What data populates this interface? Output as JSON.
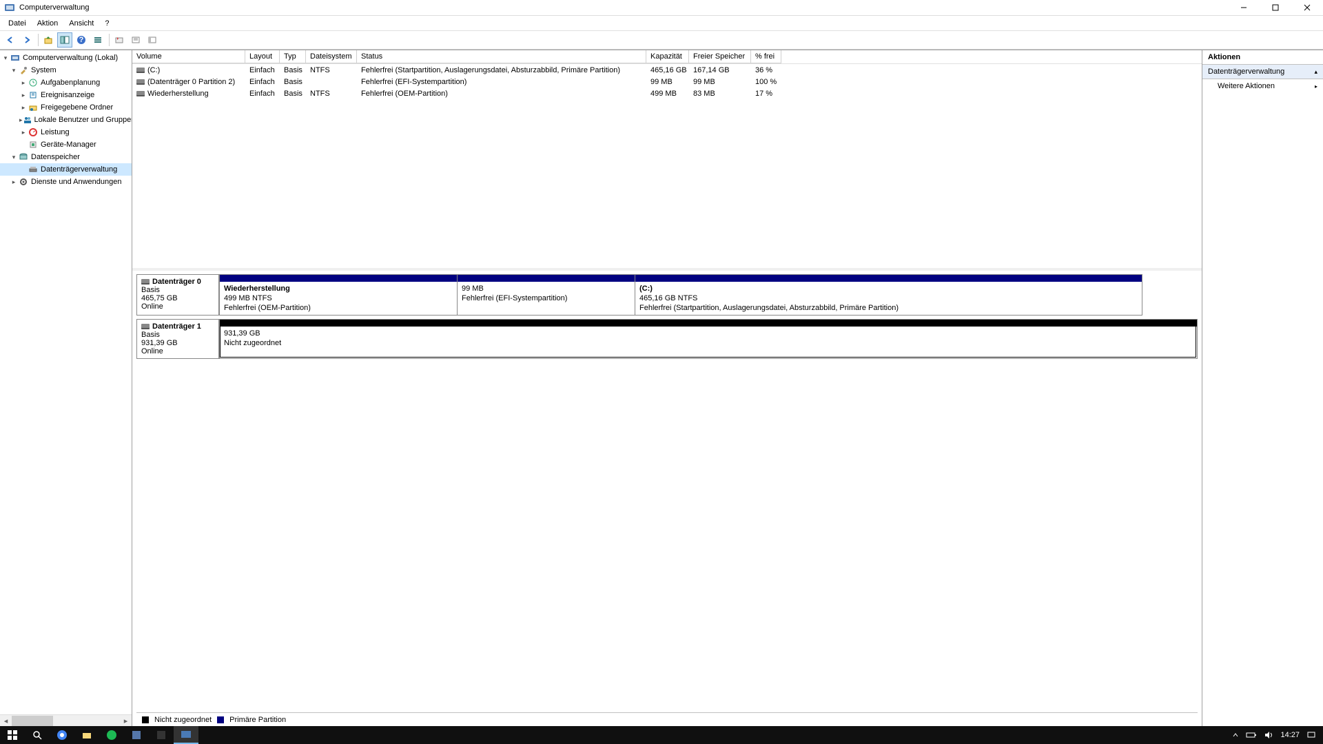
{
  "window": {
    "title": "Computerverwaltung"
  },
  "menu": {
    "file": "Datei",
    "action": "Aktion",
    "view": "Ansicht",
    "help": "?"
  },
  "tree": {
    "root": "Computerverwaltung (Lokal)",
    "system": "System",
    "taskScheduler": "Aufgabenplanung",
    "eventViewer": "Ereignisanzeige",
    "sharedFolders": "Freigegebene Ordner",
    "localUsers": "Lokale Benutzer und Gruppen",
    "performance": "Leistung",
    "deviceManager": "Geräte-Manager",
    "storage": "Datenspeicher",
    "diskMgmt": "Datenträgerverwaltung",
    "services": "Dienste und Anwendungen"
  },
  "columns": {
    "volume": "Volume",
    "layout": "Layout",
    "type": "Typ",
    "filesystem": "Dateisystem",
    "status": "Status",
    "capacity": "Kapazität",
    "free": "Freier Speicher",
    "pctfree": "% frei"
  },
  "volumes": [
    {
      "name": "(C:)",
      "layout": "Einfach",
      "type": "Basis",
      "fs": "NTFS",
      "status": "Fehlerfrei (Startpartition, Auslagerungsdatei, Absturzabbild, Primäre Partition)",
      "cap": "465,16 GB",
      "free": "167,14 GB",
      "pct": "36 %"
    },
    {
      "name": "(Datenträger 0 Partition 2)",
      "layout": "Einfach",
      "type": "Basis",
      "fs": "",
      "status": "Fehlerfrei (EFI-Systempartition)",
      "cap": "99 MB",
      "free": "99 MB",
      "pct": "100 %"
    },
    {
      "name": "Wiederherstellung",
      "layout": "Einfach",
      "type": "Basis",
      "fs": "NTFS",
      "status": "Fehlerfrei (OEM-Partition)",
      "cap": "499 MB",
      "free": "83 MB",
      "pct": "17 %"
    }
  ],
  "disk0": {
    "title": "Datenträger 0",
    "type": "Basis",
    "size": "465,75 GB",
    "state": "Online",
    "p1": {
      "name": "Wiederherstellung",
      "line2": "499 MB NTFS",
      "line3": "Fehlerfrei (OEM-Partition)"
    },
    "p2": {
      "name": "",
      "line2": "99 MB",
      "line3": "Fehlerfrei (EFI-Systempartition)"
    },
    "p3": {
      "name": "(C:)",
      "line2": "465,16 GB NTFS",
      "line3": "Fehlerfrei (Startpartition, Auslagerungsdatei, Absturzabbild, Primäre Partition)"
    }
  },
  "disk1": {
    "title": "Datenträger 1",
    "type": "Basis",
    "size": "931,39 GB",
    "state": "Online",
    "p1": {
      "name": "",
      "line2": "931,39 GB",
      "line3": "Nicht zugeordnet"
    }
  },
  "legend": {
    "unallocated": "Nicht zugeordnet",
    "primary": "Primäre Partition"
  },
  "actions": {
    "header": "Aktionen",
    "section": "Datenträgerverwaltung",
    "more": "Weitere Aktionen"
  },
  "tray": {
    "time": "14:27"
  }
}
